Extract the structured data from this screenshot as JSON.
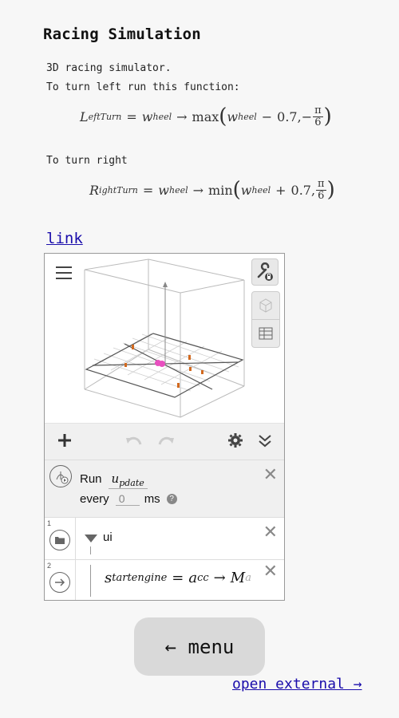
{
  "page": {
    "title": "Racing Simulation",
    "intro_line1": "3D racing simulator.",
    "intro_line2": "To turn left run this function:",
    "turn_right_text": "To turn right",
    "link_text": "link"
  },
  "formulas": {
    "left": {
      "lhs_main": "L",
      "lhs_sub": "eftTurn",
      "eq": "=",
      "w1": "w",
      "w1_sub": "heel",
      "arrow": "→",
      "fn": "max",
      "w2": "w",
      "w2_sub": "heel",
      "op": "−",
      "num": "0.7,",
      "sign": "−",
      "frac_num": "π",
      "frac_den": "6"
    },
    "right": {
      "lhs_main": "R",
      "lhs_sub": "ightTurn",
      "eq": "=",
      "w1": "w",
      "w1_sub": "heel",
      "arrow": "→",
      "fn": "min",
      "w2": "w",
      "w2_sub": "heel",
      "op": "+",
      "num": "0.7,",
      "frac_num": "π",
      "frac_den": "6"
    }
  },
  "applet": {
    "icons": [
      "menu-icon",
      "wrench-lock-icon",
      "cube-icon",
      "table-icon",
      "plus-icon",
      "undo-icon",
      "redo-icon",
      "gear-icon",
      "collapse-icon",
      "close-icon"
    ],
    "run_row": {
      "run_label": "Run",
      "script_main": "u",
      "script_sub": "pdate",
      "every_label": "every",
      "interval_value": "0",
      "unit": "ms",
      "help": "?"
    },
    "rows": [
      {
        "number": "1",
        "label": "ui"
      },
      {
        "number": "2",
        "lhs": "s",
        "lhs_sub": "tartengine",
        "eq": "=",
        "a": "a",
        "a_sub": "cc",
        "arrow": "→",
        "m": "M",
        "m_sub": "a"
      }
    ],
    "colors": {
      "point_pink": "#e84fbf",
      "point_orange": "#d2691e"
    }
  },
  "nav": {
    "menu_label": "← menu",
    "external_label": "open external →"
  }
}
